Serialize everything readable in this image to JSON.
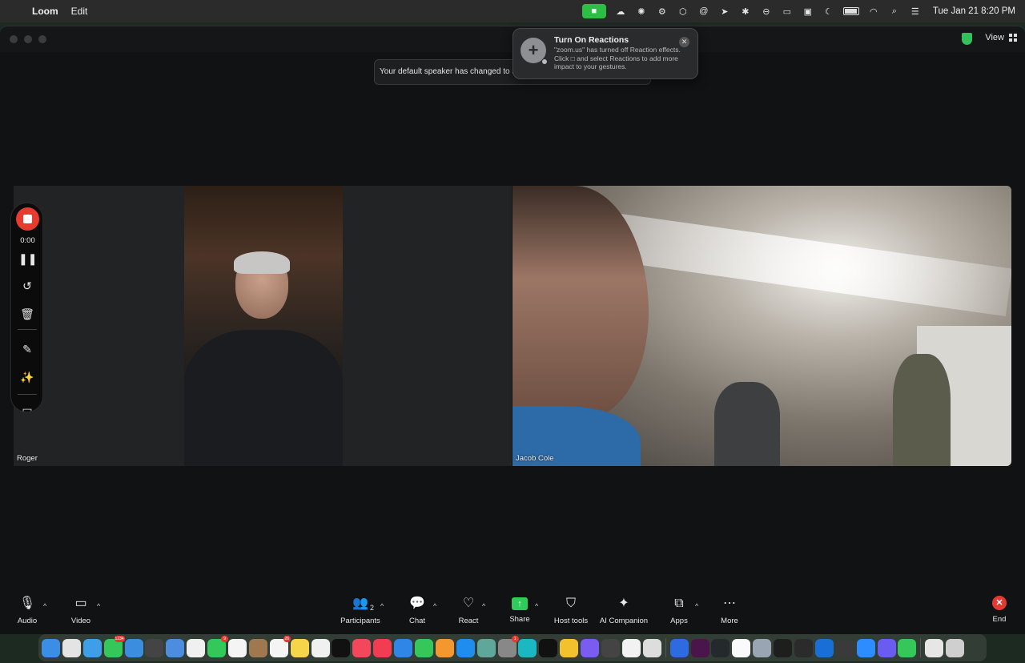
{
  "menubar": {
    "app_name": "Loom",
    "menu_edit": "Edit",
    "datetime": "Tue Jan 21  8:20 PM"
  },
  "window": {
    "view_label": "View",
    "speaker_toast": "Your default speaker has changed to Lo"
  },
  "notification": {
    "title": "Turn On Reactions",
    "body": "\"zoom.us\" has turned off Reaction effects. Click □ and select Reactions to add more impact to your gestures.",
    "close_icon": "✕"
  },
  "participants": [
    {
      "name": "Roger"
    },
    {
      "name": "Jacob Cole"
    }
  ],
  "loom_recorder": {
    "timer": "0:00"
  },
  "toolbar": {
    "audio": "Audio",
    "video": "Video",
    "participants": "Participants",
    "participants_count": "2",
    "chat": "Chat",
    "react": "React",
    "share": "Share",
    "host_tools": "Host tools",
    "ai_companion": "AI Companion",
    "apps": "Apps",
    "more": "More",
    "end": "End"
  },
  "dock": {
    "badges": {
      "messages": "1234",
      "facetime": "9",
      "reminders": "26",
      "chatgpt": "1"
    }
  },
  "colors": {
    "record_red": "#e63b2e",
    "share_green": "#2ecc5b",
    "end_red": "#e23a33",
    "camera_indicator": "#2fbe44"
  }
}
